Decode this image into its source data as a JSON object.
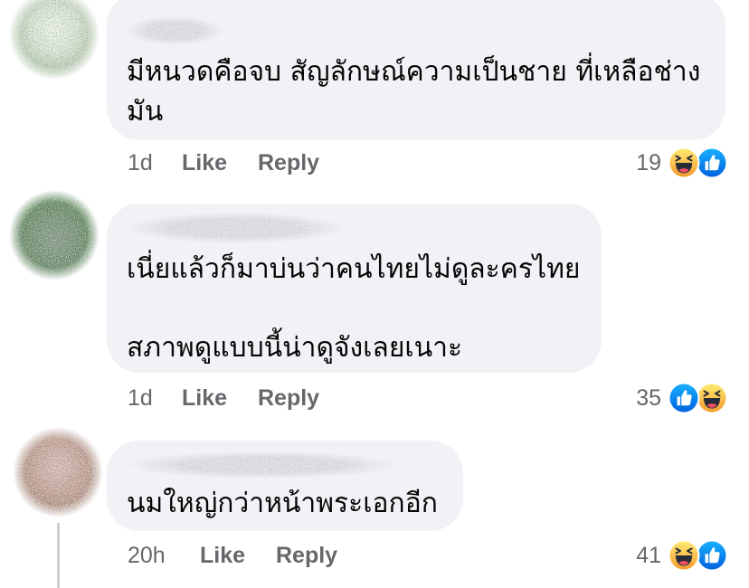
{
  "colors": {
    "bubble": "#f0f2f5",
    "text": "#050505",
    "meta": "#65676b",
    "thread_line": "#ced0d4",
    "like_blue": "#1877f2",
    "haha_yellow": "#f7b928"
  },
  "comments": [
    {
      "lines": [
        "มีหนวดคือจบ สัญลักษณ์ความเป็นชาย ที่เหลือช่าง",
        "มัน"
      ],
      "time": "1d",
      "like_label": "Like",
      "reply_label": "Reply",
      "reaction_count": "19",
      "reactions": [
        "haha-icon",
        "like-icon"
      ]
    },
    {
      "lines": [
        "เนี่ยแล้วก็มาบ่นว่าคนไทยไม่ดูละครไทย",
        "สภาพดูแบบนี้น่าดูจังเลยเนาะ"
      ],
      "time": "1d",
      "like_label": "Like",
      "reply_label": "Reply",
      "reaction_count": "35",
      "reactions": [
        "like-icon",
        "haha-icon"
      ]
    },
    {
      "lines": [
        "นมใหญ่กว่าหน้าพระเอกอีก"
      ],
      "time": "20h",
      "like_label": "Like",
      "reply_label": "Reply",
      "reaction_count": "41",
      "reactions": [
        "haha-icon",
        "like-icon"
      ]
    }
  ]
}
